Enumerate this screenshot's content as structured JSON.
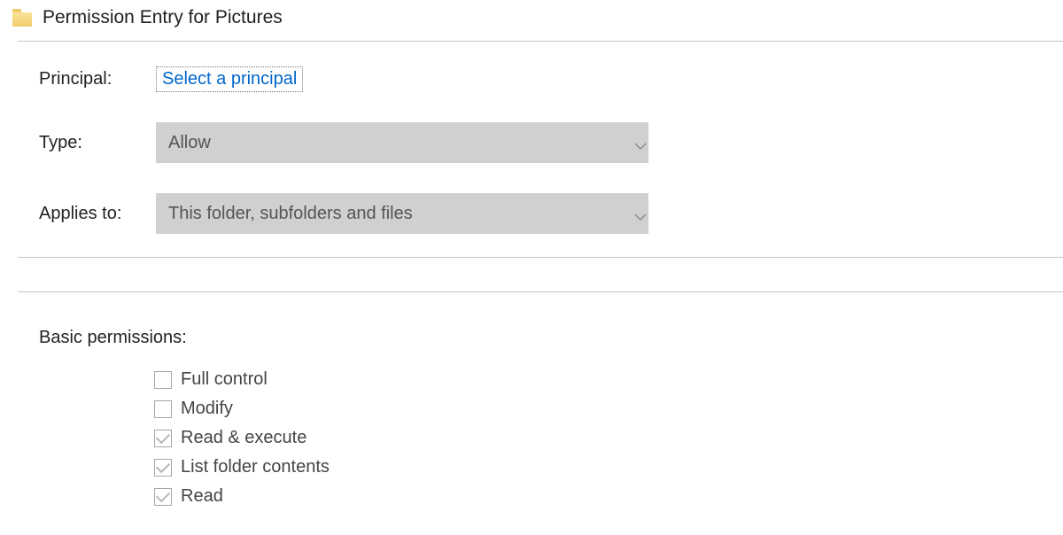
{
  "window": {
    "title": "Permission Entry for Pictures"
  },
  "form": {
    "principal_label": "Principal:",
    "principal_link": "Select a principal",
    "type_label": "Type:",
    "type_value": "Allow",
    "applies_label": "Applies to:",
    "applies_value": "This folder, subfolders and files"
  },
  "permissions": {
    "section_label": "Basic permissions:",
    "items": [
      {
        "label": "Full control",
        "checked": false
      },
      {
        "label": "Modify",
        "checked": false
      },
      {
        "label": "Read & execute",
        "checked": true
      },
      {
        "label": "List folder contents",
        "checked": true
      },
      {
        "label": "Read",
        "checked": true
      }
    ]
  }
}
